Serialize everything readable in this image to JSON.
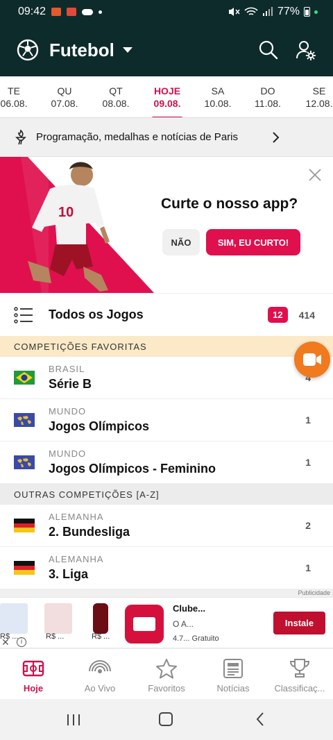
{
  "status": {
    "time": "09:42",
    "battery": "77%"
  },
  "header": {
    "title": "Futebol"
  },
  "dates": [
    {
      "day": "TE",
      "date": "06.08."
    },
    {
      "day": "QU",
      "date": "07.08."
    },
    {
      "day": "QT",
      "date": "08.08."
    },
    {
      "day": "HOJE",
      "date": "09.08.",
      "active": true
    },
    {
      "day": "SA",
      "date": "10.08."
    },
    {
      "day": "DO",
      "date": "11.08."
    },
    {
      "day": "SE",
      "date": "12.08."
    }
  ],
  "paris_banner": {
    "text": "Programação, medalhas e notícias de Paris"
  },
  "promo": {
    "question": "Curte o nosso app?",
    "no_label": "NÃO",
    "yes_label": "SIM, EU CURTO!",
    "player_number": "10"
  },
  "all_games": {
    "label": "Todos os Jogos",
    "live_count": "12",
    "total": "414"
  },
  "sections": {
    "favorites": "COMPETIÇÕES FAVORITAS",
    "others": "OUTRAS COMPETIÇÕES [A-Z]"
  },
  "favorites": [
    {
      "country": "BRASIL",
      "name": "Série B",
      "count": "4"
    },
    {
      "country": "MUNDO",
      "name": "Jogos Olímpicos",
      "count": "1"
    },
    {
      "country": "MUNDO",
      "name": "Jogos Olímpicos - Feminino",
      "count": "1"
    }
  ],
  "others": [
    {
      "country": "ALEMANHA",
      "name": "2. Bundesliga",
      "count": "2"
    },
    {
      "country": "ALEMANHA",
      "name": "3. Liga",
      "count": "1"
    }
  ],
  "ad": {
    "publicidade": "Publicidade",
    "prices": [
      "R$ ...",
      "R$ ...",
      "R$ ..."
    ],
    "app_name": "Clube...",
    "app_desc": "O A...",
    "app_meta": "4.7...  Gratuito",
    "install_label": "Instale"
  },
  "bottom_nav": [
    {
      "label": "Hoje",
      "icon": "pitch-icon",
      "active": true
    },
    {
      "label": "Ao Vivo",
      "icon": "live-icon"
    },
    {
      "label": "Favoritos",
      "icon": "star-icon"
    },
    {
      "label": "Notícias",
      "icon": "news-icon"
    },
    {
      "label": "Classificaç...",
      "icon": "trophy-icon"
    }
  ],
  "colors": {
    "header_bg": "#0e2b2c",
    "accent": "#d0104a",
    "fav_section_bg": "#fbe9c7",
    "fab": "#f07a1d"
  }
}
